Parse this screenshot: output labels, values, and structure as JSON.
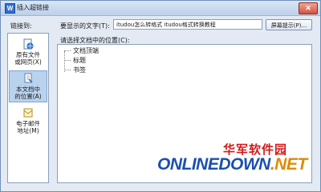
{
  "window": {
    "title": "插入超链接",
    "close_label": "✕"
  },
  "link_to_label": "链接到:",
  "display_text_label": "要显示的文字(T):",
  "display_text_value": "itudou怎么转格式  itudou格式转换教程",
  "screentip_label": "屏幕提示(P)...",
  "sidebar": {
    "items": [
      {
        "line1": "原有文件",
        "line2": "或网页(X)"
      },
      {
        "line1": "本文档中",
        "line2": "的位置(A)"
      },
      {
        "line1": "电子邮件",
        "line2": "地址(M)"
      }
    ],
    "selected_index": 1
  },
  "content_label": "请选择文档中的位置(C):",
  "tree": {
    "items": [
      "文档顶端",
      "标题",
      "书签"
    ]
  },
  "watermark": {
    "cn": "华军软件园",
    "en": "ONLINEDOWN",
    "suffix": ".NET"
  },
  "colors": {
    "accent": "#2f6fd0",
    "selected_bg": "#b9d2ee",
    "watermark_red": "#d21a1a",
    "watermark_blue": "#1b4fb0"
  },
  "icons": {
    "app": "wps-word-icon",
    "file": "web-page-icon",
    "document": "document-place-icon",
    "email": "email-icon",
    "close": "close-icon"
  }
}
